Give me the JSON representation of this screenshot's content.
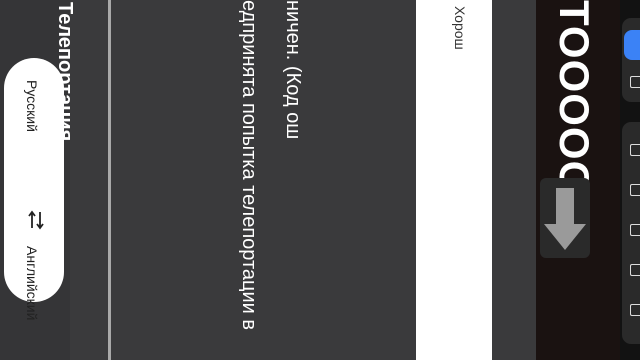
{
  "translator": {
    "source_lang": "Английский",
    "target_lang": "Русский",
    "title": "Телепортация",
    "line1": "едпринята попытка телепортации в",
    "line2": "ничен. (Код ош",
    "ok_button": "Хорош"
  },
  "game": {
    "big_text": "TOOOOOO"
  },
  "icons": [
    "swap-icon",
    "down-arrow-icon",
    "screenshot-icon",
    "crop-icon",
    "paint-icon",
    "text-icon",
    "plus-icon",
    "move-icon",
    "copy-icon"
  ],
  "colors": {
    "accent": "#3b82f6",
    "panel": "#3a3a3c",
    "divider": "#a9a9a9"
  }
}
